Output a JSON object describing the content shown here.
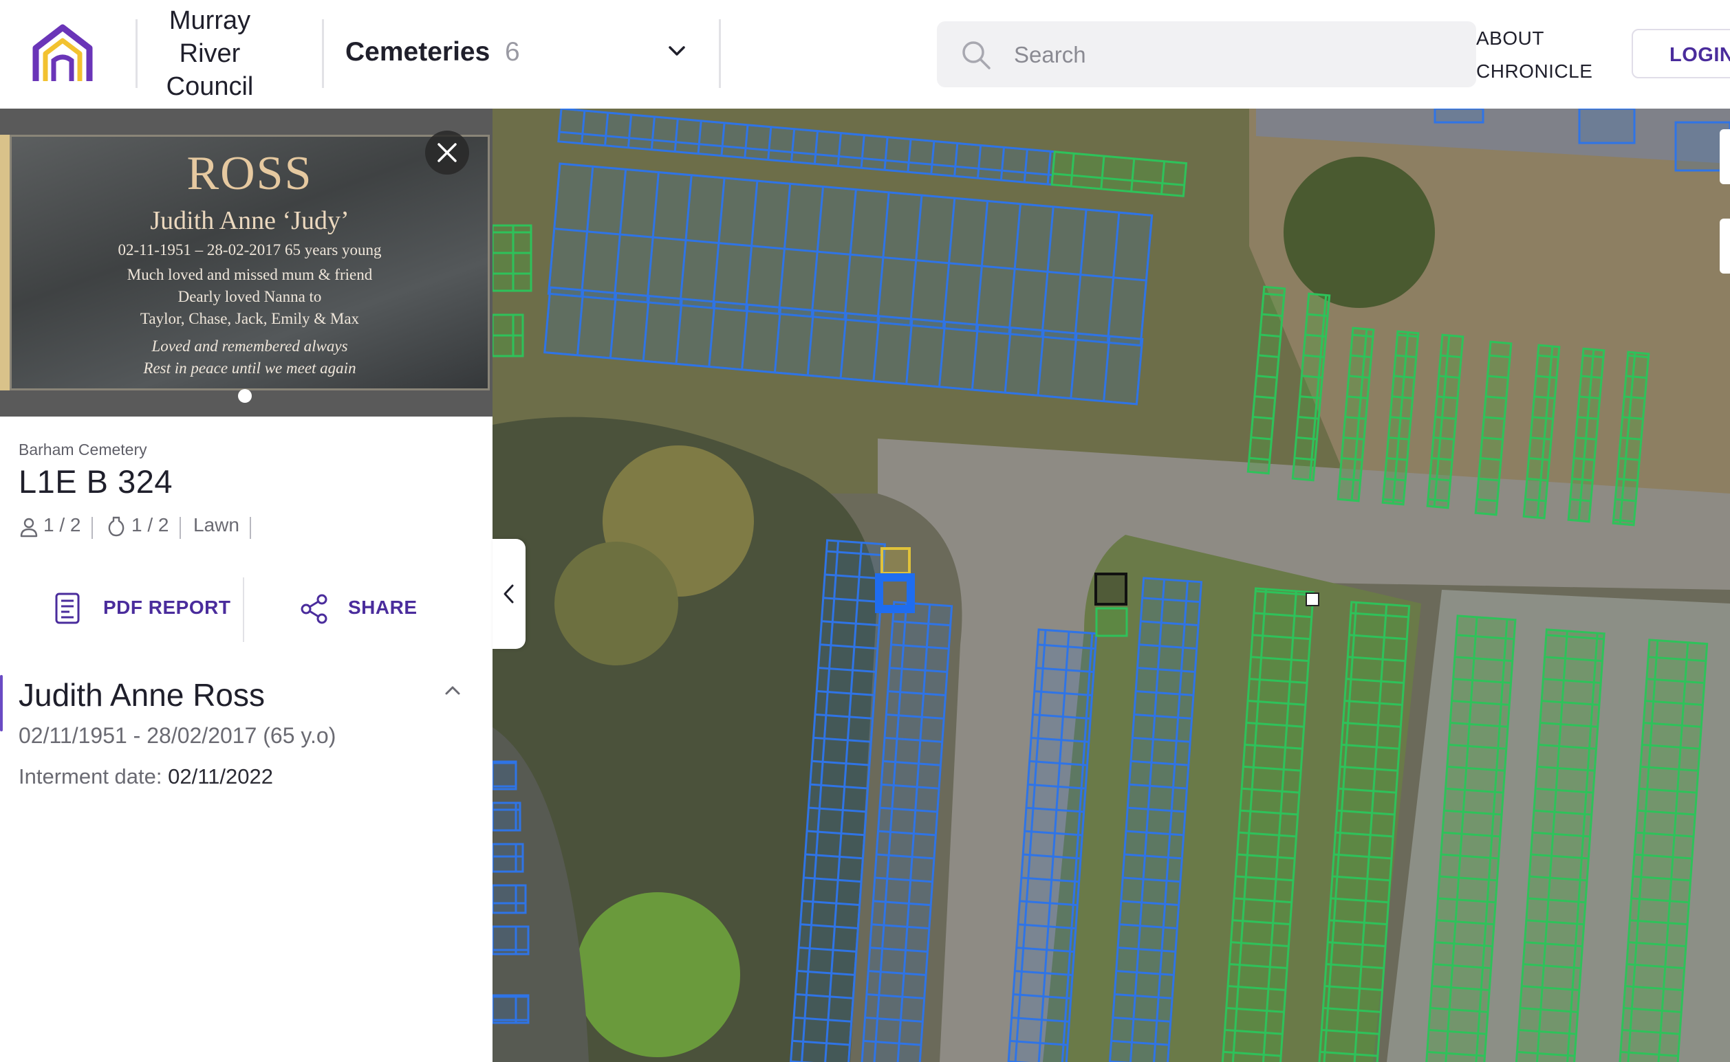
{
  "header": {
    "council_name": "Murray River Council",
    "cemeteries_label": "Cemeteries",
    "cemeteries_count": "6",
    "search_placeholder": "Search",
    "about_label": "ABOUT CHRONICLE",
    "login_label": "LOGIN",
    "brand_color": "#4a2c9c",
    "logo_colors": [
      "#6a35b8",
      "#f2c230"
    ]
  },
  "photo": {
    "surname": "ROSS",
    "given": "Judith Anne ‘Judy’",
    "dates_line": "02-11-1951 – 28-02-2017   65 years young",
    "line1": "Much loved and missed mum & friend",
    "line2": "Dearly loved Nanna to",
    "line3": "Taylor, Chase, Jack, Emily & Max",
    "line4": "Loved and remembered always",
    "line5": "Rest in peace until we meet again",
    "carousel_index": 1,
    "carousel_total": 1
  },
  "plot": {
    "cemetery": "Barham Cemetery",
    "id": "L1E B 324",
    "persons": "1 / 2",
    "urns": "1 / 2",
    "type": "Lawn"
  },
  "actions": {
    "pdf_label": "PDF REPORT",
    "share_label": "SHARE"
  },
  "person": {
    "name": "Judith Anne Ross",
    "dates": "02/11/1951 - 28/02/2017 (65 y.o)",
    "interment_label": "Interment date:",
    "interment_date": "02/11/2022"
  },
  "map": {
    "occupied_color": "#2f74e6",
    "available_color": "#2ec25a",
    "selected_color": "#1f6df0",
    "reserved_color": "#e0c23a"
  }
}
